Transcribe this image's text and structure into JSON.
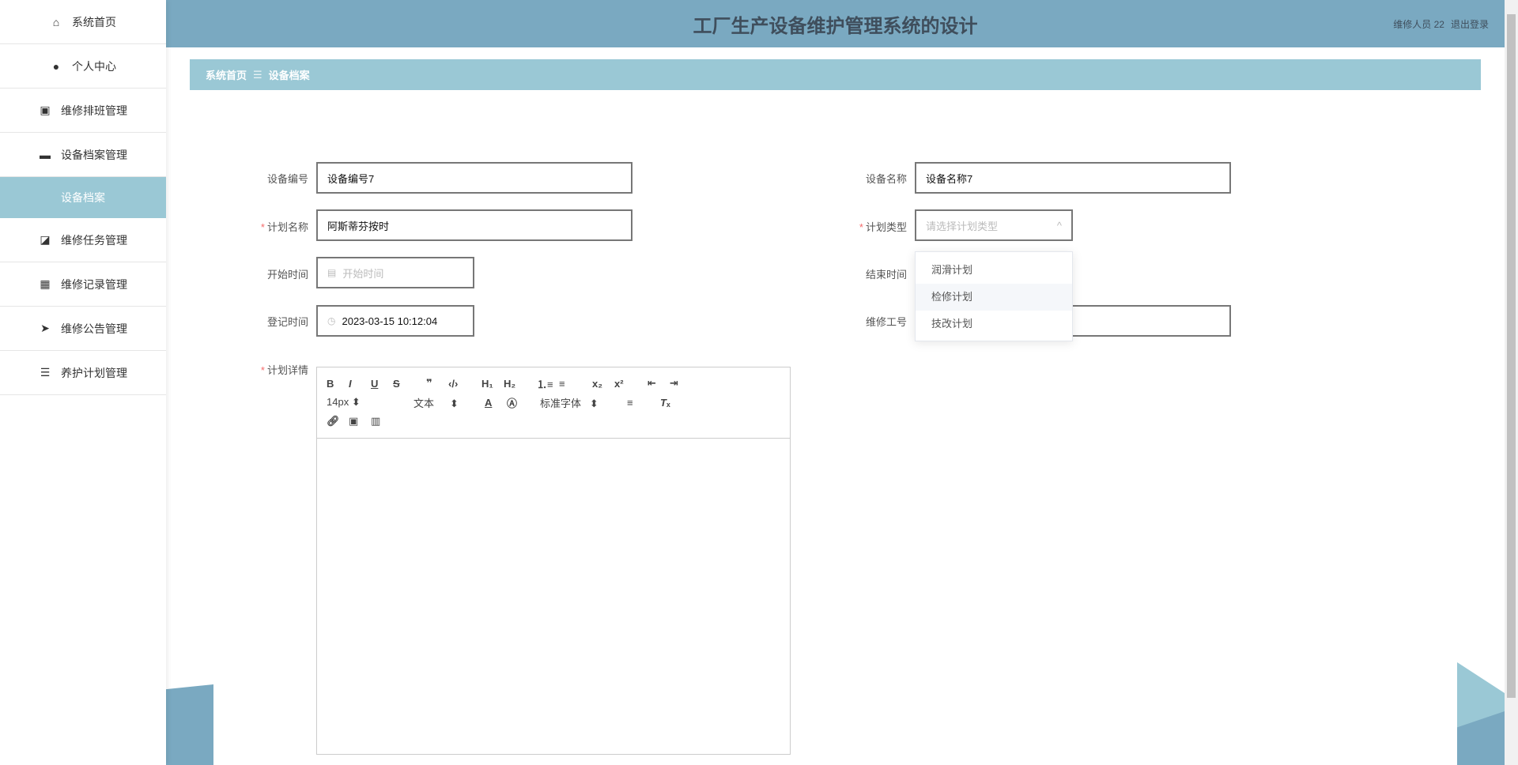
{
  "sidebar": {
    "items": [
      {
        "label": "系统首页",
        "icon": "home-icon"
      },
      {
        "label": "个人中心",
        "icon": "user-icon"
      },
      {
        "label": "维修排班管理",
        "icon": "clipboard-icon"
      },
      {
        "label": "设备档案管理",
        "icon": "briefcase-icon"
      },
      {
        "label": "设备档案",
        "icon": ""
      },
      {
        "label": "维修任务管理",
        "icon": "chart-icon"
      },
      {
        "label": "维修记录管理",
        "icon": "grid-icon"
      },
      {
        "label": "维修公告管理",
        "icon": "send-icon"
      },
      {
        "label": "养护计划管理",
        "icon": "list-icon"
      }
    ]
  },
  "header": {
    "title": "工厂生产设备维护管理系统的设计",
    "user": "维修人员 22",
    "logout": "退出登录"
  },
  "breadcrumb": {
    "home": "系统首页",
    "sep": "☰",
    "current": "设备档案"
  },
  "form": {
    "device_no": {
      "label": "设备编号",
      "value": "设备编号7"
    },
    "device_name": {
      "label": "设备名称",
      "value": "设备名称7"
    },
    "plan_name": {
      "label": "计划名称",
      "value": "阿斯蒂芬按时"
    },
    "plan_type": {
      "label": "计划类型",
      "placeholder": "请选择计划类型",
      "options": [
        "润滑计划",
        "检修计划",
        "技改计划"
      ]
    },
    "start_time": {
      "label": "开始时间",
      "placeholder": "开始时间"
    },
    "end_time": {
      "label": "结束时间"
    },
    "reg_time": {
      "label": "登记时间",
      "value": "2023-03-15 10:12:04"
    },
    "worker_no": {
      "label": "维修工号",
      "value": ""
    },
    "plan_detail": {
      "label": "计划详情"
    },
    "required_mark": "*"
  },
  "editor": {
    "font_size": "14px",
    "text_type": "文本",
    "font_family": "标准字体"
  }
}
